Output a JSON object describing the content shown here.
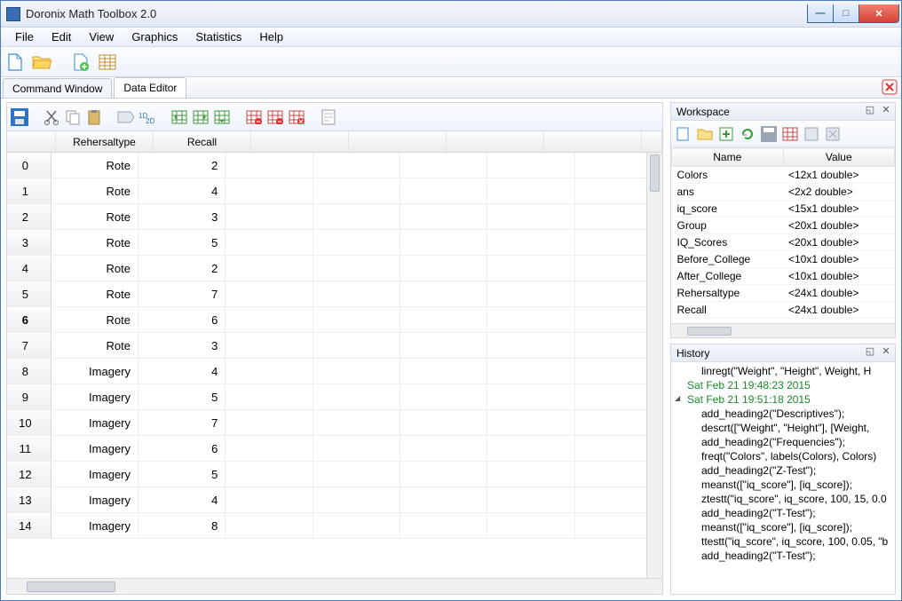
{
  "window": {
    "title": "Doronix Math Toolbox 2.0"
  },
  "menubar": [
    "File",
    "Edit",
    "View",
    "Graphics",
    "Statistics",
    "Help"
  ],
  "tabs": [
    {
      "label": "Command Window",
      "active": false
    },
    {
      "label": "Data Editor",
      "active": true
    }
  ],
  "data_editor": {
    "columns": [
      "Rehersaltype",
      "Recall"
    ],
    "rows": [
      {
        "idx": "0",
        "type": "Rote",
        "recall": "2"
      },
      {
        "idx": "1",
        "type": "Rote",
        "recall": "4"
      },
      {
        "idx": "2",
        "type": "Rote",
        "recall": "3"
      },
      {
        "idx": "3",
        "type": "Rote",
        "recall": "5"
      },
      {
        "idx": "4",
        "type": "Rote",
        "recall": "2"
      },
      {
        "idx": "5",
        "type": "Rote",
        "recall": "7"
      },
      {
        "idx": "6",
        "type": "Rote",
        "recall": "6",
        "selected": true
      },
      {
        "idx": "7",
        "type": "Rote",
        "recall": "3"
      },
      {
        "idx": "8",
        "type": "Imagery",
        "recall": "4"
      },
      {
        "idx": "9",
        "type": "Imagery",
        "recall": "5"
      },
      {
        "idx": "10",
        "type": "Imagery",
        "recall": "7"
      },
      {
        "idx": "11",
        "type": "Imagery",
        "recall": "6"
      },
      {
        "idx": "12",
        "type": "Imagery",
        "recall": "5"
      },
      {
        "idx": "13",
        "type": "Imagery",
        "recall": "4"
      },
      {
        "idx": "14",
        "type": "Imagery",
        "recall": "8"
      }
    ],
    "empty_cols": 5
  },
  "workspace": {
    "title": "Workspace",
    "headers": [
      "Name",
      "Value"
    ],
    "variables": [
      {
        "name": "Colors",
        "value": "<12x1 double>"
      },
      {
        "name": "ans",
        "value": "<2x2 double>"
      },
      {
        "name": "iq_score",
        "value": "<15x1 double>"
      },
      {
        "name": "Group",
        "value": "<20x1 double>"
      },
      {
        "name": "IQ_Scores",
        "value": "<20x1 double>"
      },
      {
        "name": "Before_College",
        "value": "<10x1 double>"
      },
      {
        "name": "After_College",
        "value": "<10x1 double>"
      },
      {
        "name": "Rehersaltype",
        "value": "<24x1 double>"
      },
      {
        "name": "Recall",
        "value": "<24x1 double>"
      }
    ]
  },
  "history": {
    "title": "History",
    "items": [
      {
        "kind": "cmd",
        "text": "linregt(\"Weight\", \"Height\", Weight, H"
      },
      {
        "kind": "head",
        "text": "Sat Feb 21 19:48:23 2015"
      },
      {
        "kind": "head",
        "text": "Sat Feb 21 19:51:18 2015",
        "expanded": true
      },
      {
        "kind": "cmd",
        "text": "add_heading2(\"Descriptives\");"
      },
      {
        "kind": "cmd",
        "text": "descrt([\"Weight\", \"Height\"], [Weight,"
      },
      {
        "kind": "cmd",
        "text": "add_heading2(\"Frequencies\");"
      },
      {
        "kind": "cmd",
        "text": "freqt(\"Colors\", labels(Colors), Colors)"
      },
      {
        "kind": "cmd",
        "text": "add_heading2(\"Z-Test\");"
      },
      {
        "kind": "cmd",
        "text": "meanst([\"iq_score\"], [iq_score]);"
      },
      {
        "kind": "cmd",
        "text": "ztestt(\"iq_score\", iq_score, 100, 15, 0.0"
      },
      {
        "kind": "cmd",
        "text": "add_heading2(\"T-Test\");"
      },
      {
        "kind": "cmd",
        "text": "meanst([\"iq_score\"], [iq_score]);"
      },
      {
        "kind": "cmd",
        "text": "ttestt(\"iq_score\", iq_score, 100, 0.05, \"b"
      },
      {
        "kind": "cmd",
        "text": "add_heading2(\"T-Test\");"
      }
    ]
  }
}
